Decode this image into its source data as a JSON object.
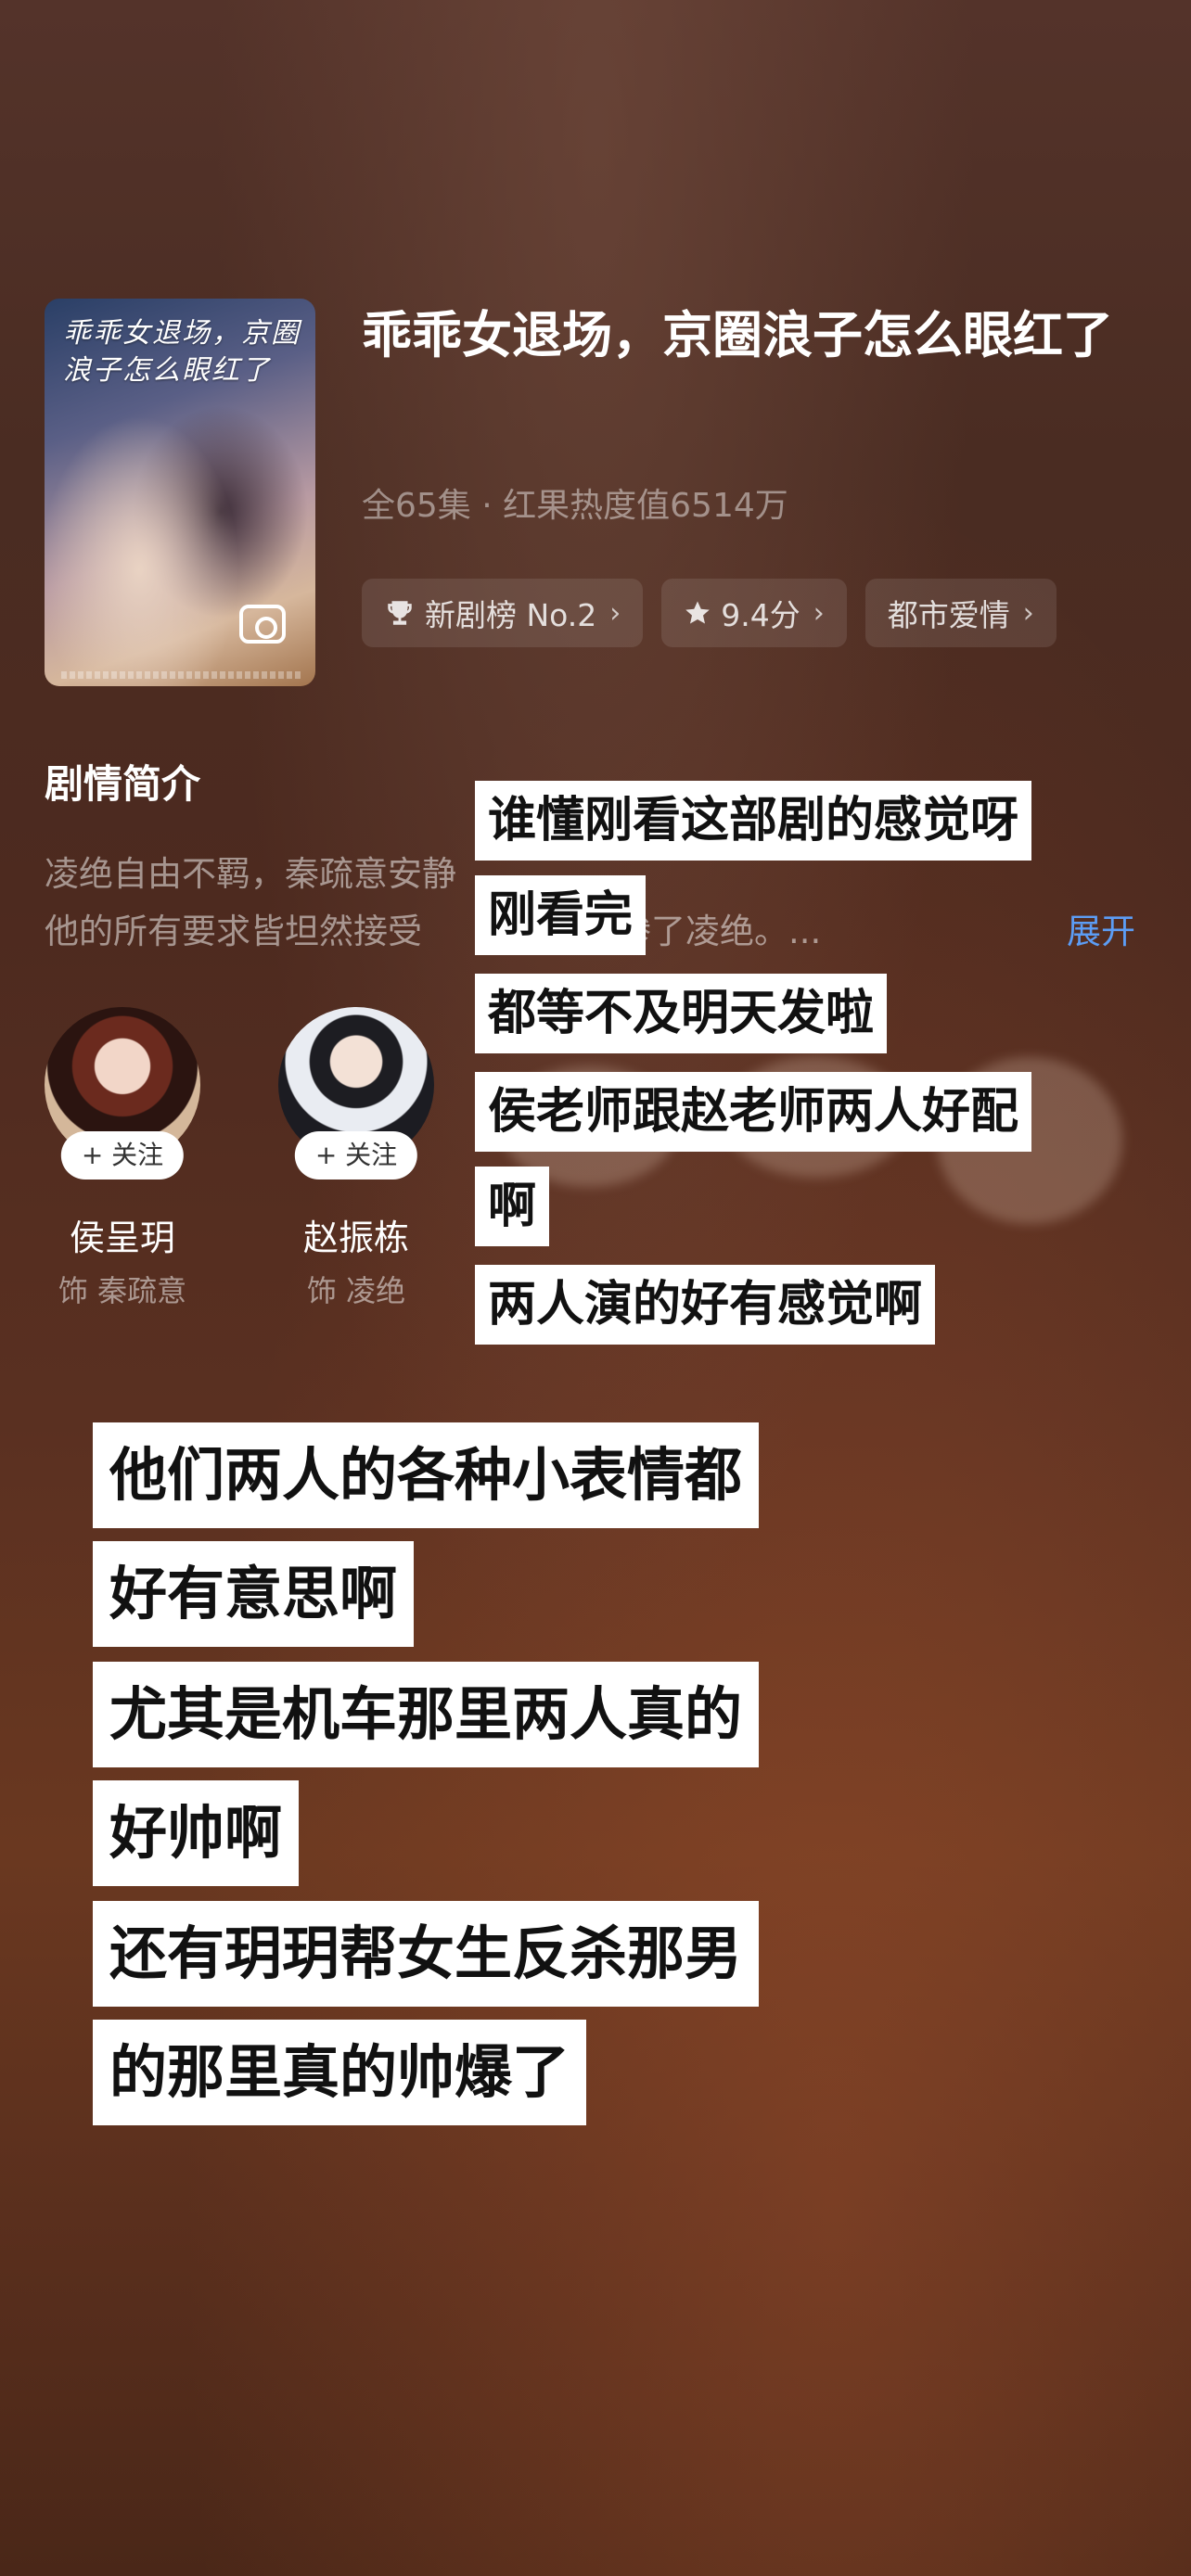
{
  "drama": {
    "poster_title": "乖乖女退场，京圈浪子怎么眼红了",
    "title": "乖乖女退场，京圈浪子怎么眼红了",
    "meta": "全65集 · 红果热度值6514万",
    "tags": [
      {
        "icon": "trophy-icon",
        "label": "新剧榜 No.2"
      },
      {
        "icon": "star-icon",
        "label": "9.4分"
      },
      {
        "icon": "",
        "label": "都市爱情"
      }
    ]
  },
  "synopsis": {
    "title": "剧情简介",
    "line1": "凌绝自由不羁，秦疏意安静",
    "line2": "他的所有要求皆坦然接受",
    "line2_tail": "惨了凌绝。...",
    "expand": "展开",
    "expand_color": "#5c9df5"
  },
  "cast": [
    {
      "name": "侯呈玥",
      "role": "饰 秦疏意",
      "follow": "+ 关注"
    },
    {
      "name": "赵振栋",
      "role": "饰 凌绝",
      "follow": "+ 关注"
    }
  ],
  "captions_a": [
    "谁懂刚看这部剧的感觉呀",
    "刚看完",
    "都等不及明天发啦",
    "侯老师跟赵老师两人好配",
    "啊",
    "两人演的好有感觉啊"
  ],
  "captions_b": [
    "他们两人的各种小表情都",
    "好有意思啊",
    "尤其是机车那里两人真的",
    "好帅啊",
    "还有玥玥帮女生反杀那男",
    "的那里真的帅爆了"
  ]
}
